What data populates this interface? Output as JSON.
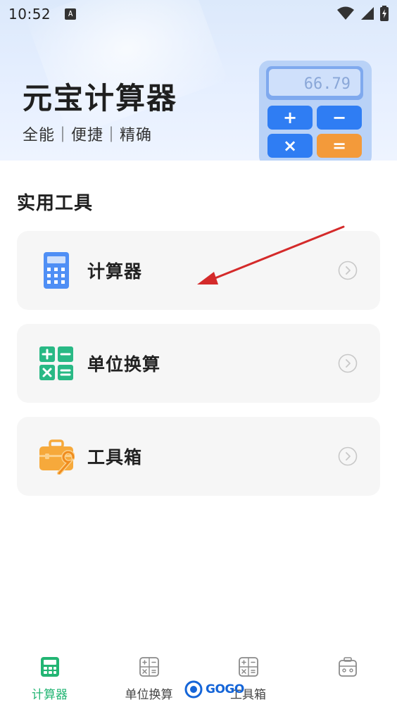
{
  "status_bar": {
    "time": "10:52",
    "notification": "A"
  },
  "header": {
    "title": "元宝计算器",
    "subtitle": "全能｜便捷｜精确",
    "display_value": "66.79",
    "keys": [
      "+",
      "−",
      "×",
      "="
    ]
  },
  "section": {
    "title": "实用工具"
  },
  "tools": [
    {
      "label": "计算器",
      "icon": "calculator-icon"
    },
    {
      "label": "单位换算",
      "icon": "conversion-icon"
    },
    {
      "label": "工具箱",
      "icon": "toolbox-icon"
    }
  ],
  "tabs": [
    {
      "label": "计算器",
      "active": true
    },
    {
      "label": "单位换算",
      "active": false
    },
    {
      "label": "工具箱",
      "active": false
    },
    {
      "label": "",
      "active": false
    }
  ],
  "watermark": {
    "text": "GOGO"
  },
  "colors": {
    "accent_green": "#22b573",
    "calc_blue": "#4f8ff5",
    "tool_orange": "#f6a93b",
    "card_bg": "#f6f6f6"
  }
}
